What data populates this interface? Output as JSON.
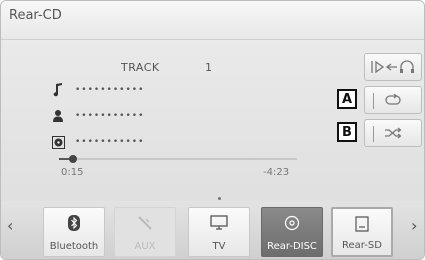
{
  "header": {
    "title": "Rear-CD"
  },
  "track": {
    "label": "TRACK",
    "number": "1"
  },
  "info": {
    "song": "•••••••••••",
    "artist": "•••••••••••",
    "album": "•••••••••••"
  },
  "progress": {
    "elapsed": "0:15",
    "remaining": "-4:23",
    "fraction": 0.06
  },
  "callouts": {
    "a": "A",
    "b": "B"
  },
  "sources": [
    {
      "label": "Bluetooth",
      "icon": "bluetooth-icon",
      "state": "normal"
    },
    {
      "label": "AUX",
      "icon": "aux-cable-icon",
      "state": "disabled"
    },
    {
      "label": "TV",
      "icon": "tv-icon",
      "state": "normal"
    },
    {
      "label": "Rear-DISC",
      "icon": "disc-icon",
      "state": "active"
    },
    {
      "label": "Rear-SD",
      "icon": "sd-card-icon",
      "state": "selected"
    }
  ]
}
